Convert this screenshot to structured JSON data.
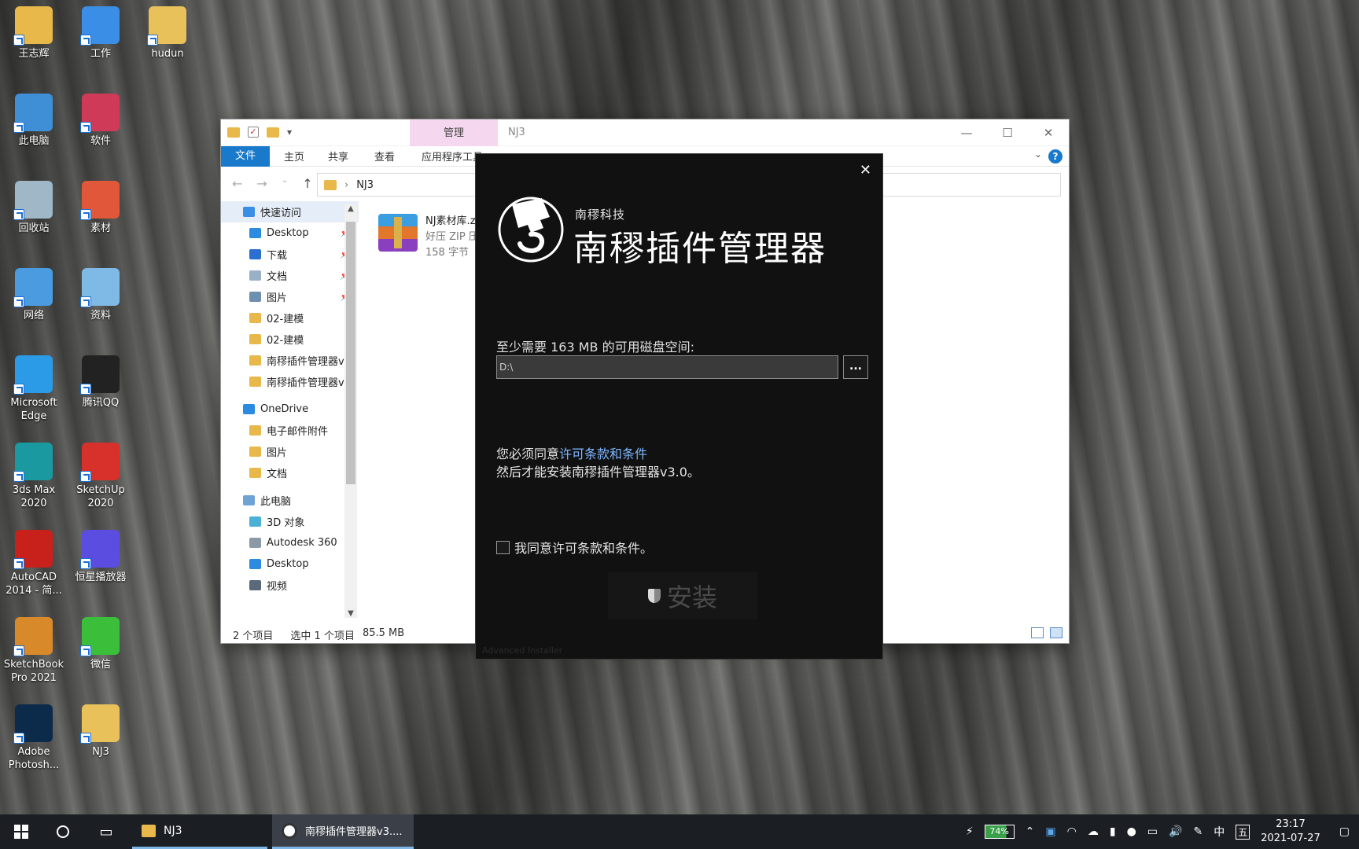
{
  "desktop": {
    "icons": [
      {
        "label": "王志辉",
        "color": "#e8b84a"
      },
      {
        "label": "工作",
        "color": "#3a8ee6"
      },
      {
        "label": "hudun",
        "color": "#e8c15a"
      },
      {
        "label": "此电脑",
        "color": "#3f8fd6"
      },
      {
        "label": "软件",
        "color": "#cf3a58"
      },
      {
        "label": "回收站",
        "color": "#9fb7c7"
      },
      {
        "label": "素材",
        "color": "#e0573a"
      },
      {
        "label": "网络",
        "color": "#4a9be0"
      },
      {
        "label": "资料",
        "color": "#7fb9e6"
      },
      {
        "label": "Microsoft Edge",
        "color": "#2b9be8"
      },
      {
        "label": "腾讯QQ",
        "color": "#222222"
      },
      {
        "label": "3ds Max 2020",
        "color": "#1a9aa0"
      },
      {
        "label": "SketchUp 2020",
        "color": "#d8302a"
      },
      {
        "label": "AutoCAD 2014 - 简...",
        "color": "#c8211b"
      },
      {
        "label": "恒星播放器",
        "color": "#5b4de0"
      },
      {
        "label": "SketchBook Pro 2021",
        "color": "#d88a2a"
      },
      {
        "label": "微信",
        "color": "#3bbf3b"
      },
      {
        "label": "Adobe Photosh...",
        "color": "#0c2a4a"
      },
      {
        "label": "NJ3",
        "color": "#e8c15a"
      }
    ]
  },
  "explorer": {
    "title": "NJ3",
    "manage_tab": "管理",
    "app_tools_tab": "应用程序工具",
    "ribbon_tabs": {
      "file": "文件",
      "home": "主页",
      "share": "共享",
      "view": "查看"
    },
    "address": "NJ3",
    "nav_items": [
      {
        "label": "快速访问",
        "icon_color": "#3a8ee6",
        "pinned": false,
        "indent": 0,
        "selected": true
      },
      {
        "label": "Desktop",
        "icon_color": "#2b8be0",
        "pinned": true,
        "indent": 1
      },
      {
        "label": "下载",
        "icon_color": "#2b6fd0",
        "pinned": true,
        "indent": 1
      },
      {
        "label": "文档",
        "icon_color": "#9ab0c6",
        "pinned": true,
        "indent": 1
      },
      {
        "label": "图片",
        "icon_color": "#6f8fb0",
        "pinned": true,
        "indent": 1
      },
      {
        "label": "02-建模",
        "icon_color": "#e8b84a",
        "pinned": false,
        "indent": 1
      },
      {
        "label": "02-建模",
        "icon_color": "#e8b84a",
        "pinned": false,
        "indent": 1
      },
      {
        "label": "南穋插件管理器v",
        "icon_color": "#e8b84a",
        "pinned": false,
        "indent": 1
      },
      {
        "label": "南穋插件管理器v",
        "icon_color": "#e8b84a",
        "pinned": false,
        "indent": 1
      },
      {
        "label": "OneDrive",
        "icon_color": "#2b8be0",
        "pinned": false,
        "indent": 0
      },
      {
        "label": "电子邮件附件",
        "icon_color": "#e8b84a",
        "pinned": false,
        "indent": 1
      },
      {
        "label": "图片",
        "icon_color": "#e8b84a",
        "pinned": false,
        "indent": 1
      },
      {
        "label": "文档",
        "icon_color": "#e8b84a",
        "pinned": false,
        "indent": 1
      },
      {
        "label": "此电脑",
        "icon_color": "#6fa3d6",
        "pinned": false,
        "indent": 0
      },
      {
        "label": "3D 对象",
        "icon_color": "#4ab0d6",
        "pinned": false,
        "indent": 1
      },
      {
        "label": "Autodesk 360",
        "icon_color": "#8c9aa8",
        "pinned": false,
        "indent": 1
      },
      {
        "label": "Desktop",
        "icon_color": "#2b8be0",
        "pinned": false,
        "indent": 1
      },
      {
        "label": "视频",
        "icon_color": "#5a6a7a",
        "pinned": false,
        "indent": 1
      }
    ],
    "file": {
      "name": "NJ素材库.z",
      "type": "好压 ZIP 压",
      "size": "158 字节"
    },
    "status": {
      "count": "2 个项目",
      "selected": "选中 1 个项目",
      "size": "85.5 MB"
    }
  },
  "installer": {
    "company": "南穋科技",
    "product": "南穋插件管理器",
    "disk_space_label": "至少需要 163 MB 的可用磁盘空间:",
    "install_path": "D:\\",
    "browse_label": "...",
    "license_prefix": "您必须同意",
    "license_link": "许可条款和条件",
    "license_line2": "然后才能安装南穋插件管理器v3.0。",
    "agree_label": "我同意许可条款和条件。",
    "install_label": "安装",
    "credit": "Advanced Installer"
  },
  "taskbar": {
    "explorer_task": "NJ3",
    "installer_task": "南穋插件管理器v3....",
    "battery": "74%",
    "ime": "中",
    "ime_mode": "五",
    "time": "23:17",
    "date": "2021-07-27"
  },
  "colors": {
    "accent": "#1979ca",
    "link": "#7db7ff",
    "manage_tab": "#f5d8f0"
  }
}
